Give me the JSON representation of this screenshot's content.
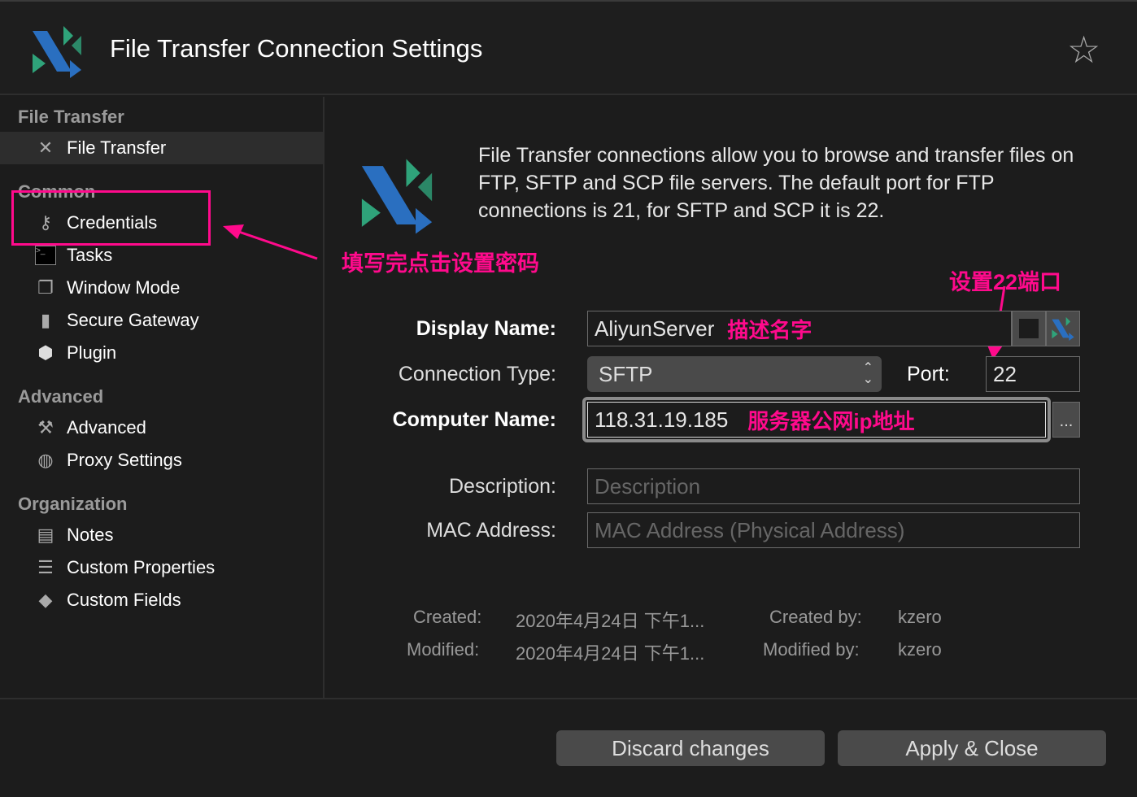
{
  "header": {
    "title": "File Transfer Connection Settings",
    "logo": "file-transfer-logo",
    "favorite_icon": "star-icon"
  },
  "sidebar": {
    "sections": [
      {
        "title": "File Transfer",
        "items": [
          {
            "label": "File Transfer",
            "icon": "file-transfer-icon",
            "selected": true
          }
        ]
      },
      {
        "title": "Common",
        "items": [
          {
            "label": "Credentials",
            "icon": "key-icon"
          },
          {
            "label": "Tasks",
            "icon": "terminal-icon"
          },
          {
            "label": "Window Mode",
            "icon": "window-icon"
          },
          {
            "label": "Secure Gateway",
            "icon": "gateway-icon"
          },
          {
            "label": "Plugin",
            "icon": "plugin-icon"
          }
        ]
      },
      {
        "title": "Advanced",
        "items": [
          {
            "label": "Advanced",
            "icon": "tools-icon"
          },
          {
            "label": "Proxy Settings",
            "icon": "globe-icon"
          }
        ]
      },
      {
        "title": "Organization",
        "items": [
          {
            "label": "Notes",
            "icon": "notes-icon"
          },
          {
            "label": "Custom Properties",
            "icon": "list-icon"
          },
          {
            "label": "Custom Fields",
            "icon": "tag-icon"
          }
        ]
      }
    ]
  },
  "main": {
    "intro": "File Transfer connections allow you to browse and transfer files on FTP, SFTP and SCP file servers. The default port for FTP connections is 21, for SFTP and SCP it is 22.",
    "display_name": {
      "label": "Display Name:",
      "value": "AliyunServer"
    },
    "connection_type": {
      "label": "Connection Type:",
      "value": "SFTP"
    },
    "port": {
      "label": "Port:",
      "value": "22"
    },
    "computer_name": {
      "label": "Computer Name:",
      "value": "118.31.19.185",
      "browse": "..."
    },
    "description": {
      "label": "Description:",
      "placeholder": "Description"
    },
    "mac": {
      "label": "MAC Address:",
      "placeholder": "MAC Address (Physical Address)"
    },
    "meta": {
      "created_label": "Created:",
      "created": "2020年4月24日 下午1...",
      "modified_label": "Modified:",
      "modified": "2020年4月24日 下午1...",
      "created_by_label": "Created by:",
      "created_by": "kzero",
      "modified_by_label": "Modified by:",
      "modified_by": "kzero"
    }
  },
  "annotations": {
    "credentials": "填写完点击设置密码",
    "port": "设置22端口",
    "name": "描述名字",
    "ip": "服务器公网ip地址",
    "color": "#ff0a8c"
  },
  "footer": {
    "discard": "Discard changes",
    "apply": "Apply & Close"
  }
}
